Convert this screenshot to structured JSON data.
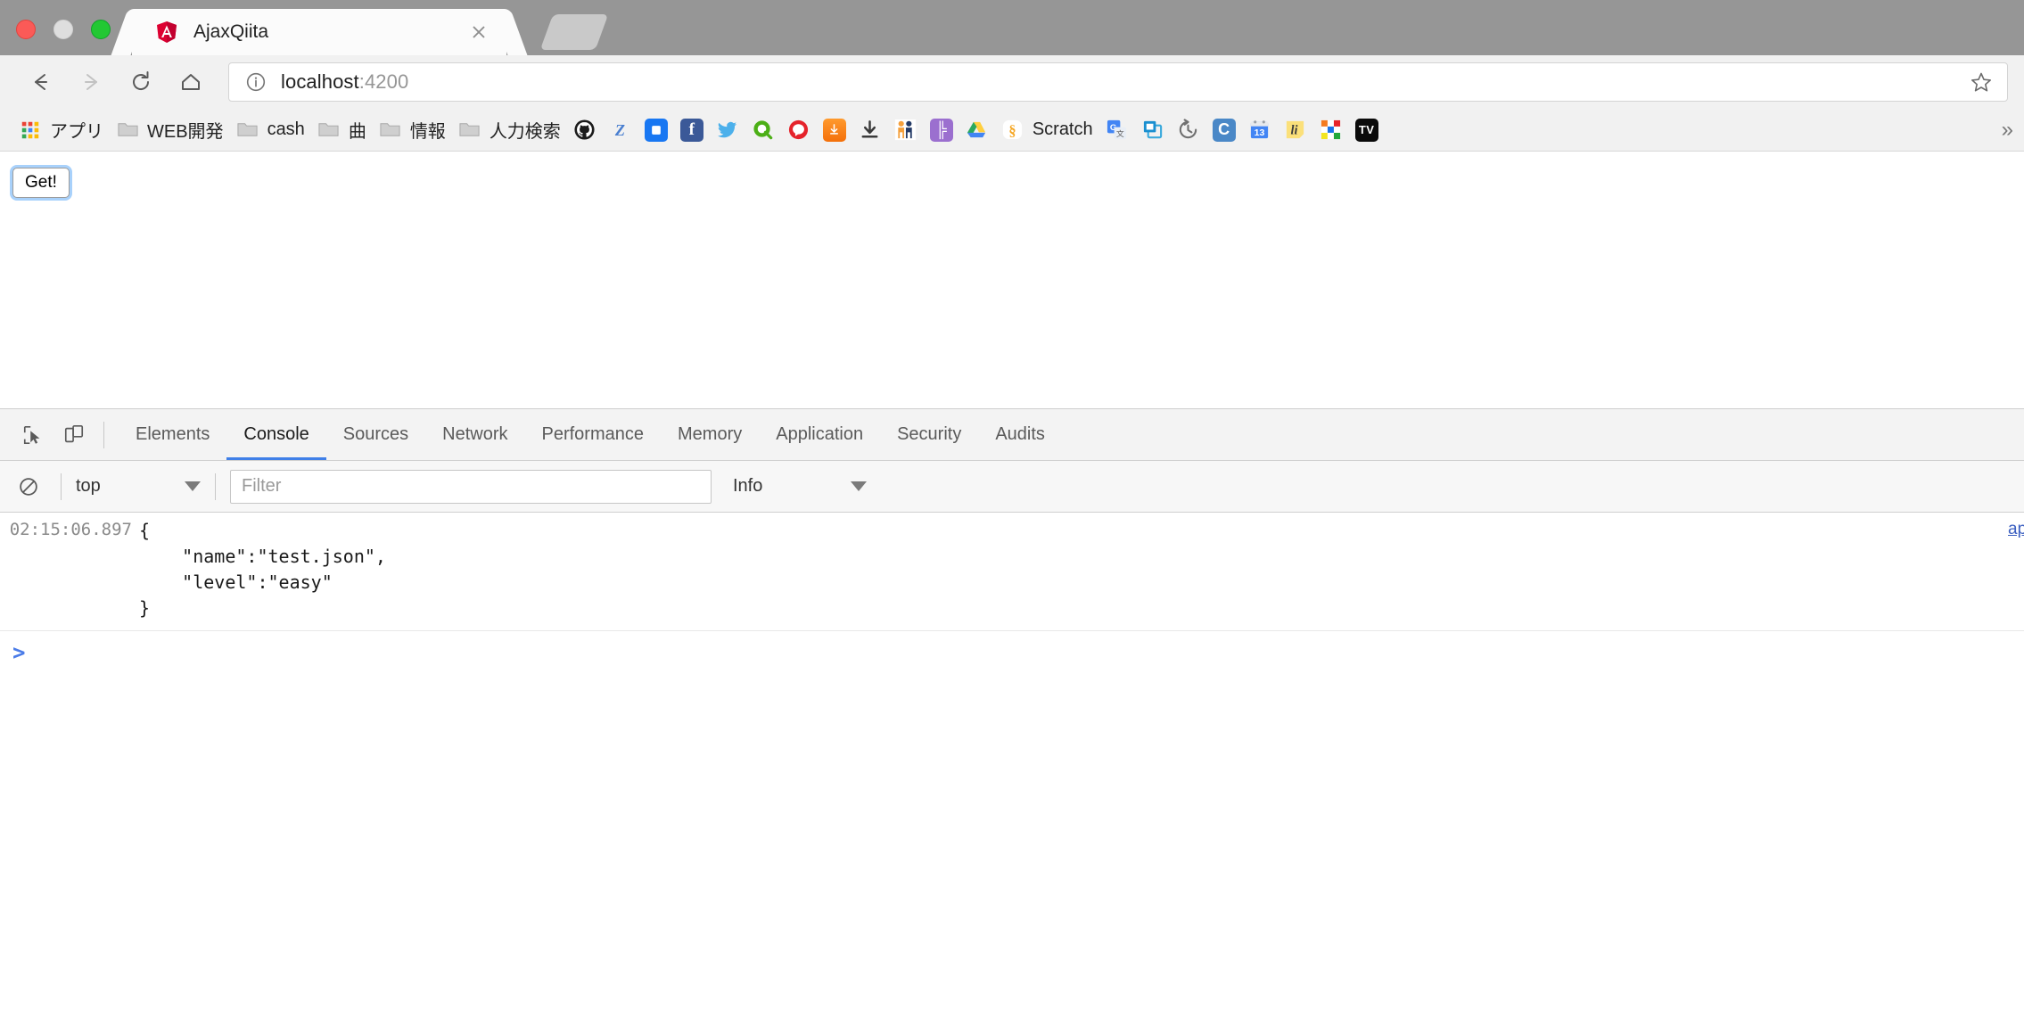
{
  "window": {
    "traffic_lights": [
      "close",
      "minimize",
      "zoom"
    ]
  },
  "tab": {
    "title": "AjaxQiita",
    "favicon": "angular-icon",
    "close_icon": "close-icon",
    "new_tab_icon": "new-tab-icon"
  },
  "toolbar": {
    "back_icon": "back-arrow-icon",
    "forward_icon": "forward-arrow-icon",
    "reload_icon": "reload-icon",
    "home_icon": "home-icon",
    "info_icon": "info-circle-icon",
    "url_host": "localhost",
    "url_port": ":4200",
    "star_icon": "bookmark-star-icon"
  },
  "bookmarks": {
    "overflow": "»",
    "items": [
      {
        "label": "アプリ",
        "icon": "apps-grid-icon"
      },
      {
        "label": "WEB開発",
        "icon": "folder-icon"
      },
      {
        "label": "cash",
        "icon": "folder-icon"
      },
      {
        "label": "曲",
        "icon": "folder-icon"
      },
      {
        "label": "情報",
        "icon": "folder-icon"
      },
      {
        "label": "人力検索",
        "icon": "folder-icon"
      },
      {
        "label": "",
        "icon": "github-icon"
      },
      {
        "label": "",
        "icon": "zenn-z-icon"
      },
      {
        "label": "",
        "icon": "blue-square-icon"
      },
      {
        "label": "",
        "icon": "facebook-icon"
      },
      {
        "label": "",
        "icon": "twitter-icon"
      },
      {
        "label": "",
        "icon": "green-search-icon"
      },
      {
        "label": "",
        "icon": "red-chat-icon"
      },
      {
        "label": "",
        "icon": "orange-download-icon"
      },
      {
        "label": "",
        "icon": "download-arrow-icon"
      },
      {
        "label": "",
        "icon": "people-icon"
      },
      {
        "label": "",
        "icon": "hatena-icon"
      },
      {
        "label": "",
        "icon": "google-drive-icon"
      },
      {
        "label": "Scratch",
        "icon": "scratch-icon"
      },
      {
        "label": "",
        "icon": "google-translate-icon"
      },
      {
        "label": "",
        "icon": "windows-stack-icon"
      },
      {
        "label": "",
        "icon": "history-clock-icon"
      },
      {
        "label": "",
        "icon": "pocket-c-icon"
      },
      {
        "label": "",
        "icon": "google-calendar-13-icon"
      },
      {
        "label": "",
        "icon": "lifehacker-li-icon"
      },
      {
        "label": "",
        "icon": "color-grid-icon"
      },
      {
        "label": "",
        "icon": "tv-icon"
      }
    ]
  },
  "page": {
    "get_button": "Get!"
  },
  "devtools": {
    "inspect_icon": "inspect-element-icon",
    "device_icon": "device-toolbar-icon",
    "tabs": [
      {
        "label": "Elements",
        "active": false
      },
      {
        "label": "Console",
        "active": true
      },
      {
        "label": "Sources",
        "active": false
      },
      {
        "label": "Network",
        "active": false
      },
      {
        "label": "Performance",
        "active": false
      },
      {
        "label": "Memory",
        "active": false
      },
      {
        "label": "Application",
        "active": false
      },
      {
        "label": "Security",
        "active": false
      },
      {
        "label": "Audits",
        "active": false
      }
    ],
    "filterbar": {
      "clear_icon": "clear-console-icon",
      "context": "top",
      "filter_placeholder": "Filter",
      "filter_value": "",
      "level": "Info"
    },
    "console": {
      "entries": [
        {
          "timestamp": "02:15:06.897",
          "message": "{\n    \"name\":\"test.json\",\n    \"level\":\"easy\"\n}",
          "source": "ap"
        }
      ],
      "prompt": ">"
    }
  },
  "colors": {
    "accent": "#3f7fe8",
    "titlebar": "#969696",
    "toolbar": "#f1f1f1",
    "prompt": "#4b7ce8"
  }
}
